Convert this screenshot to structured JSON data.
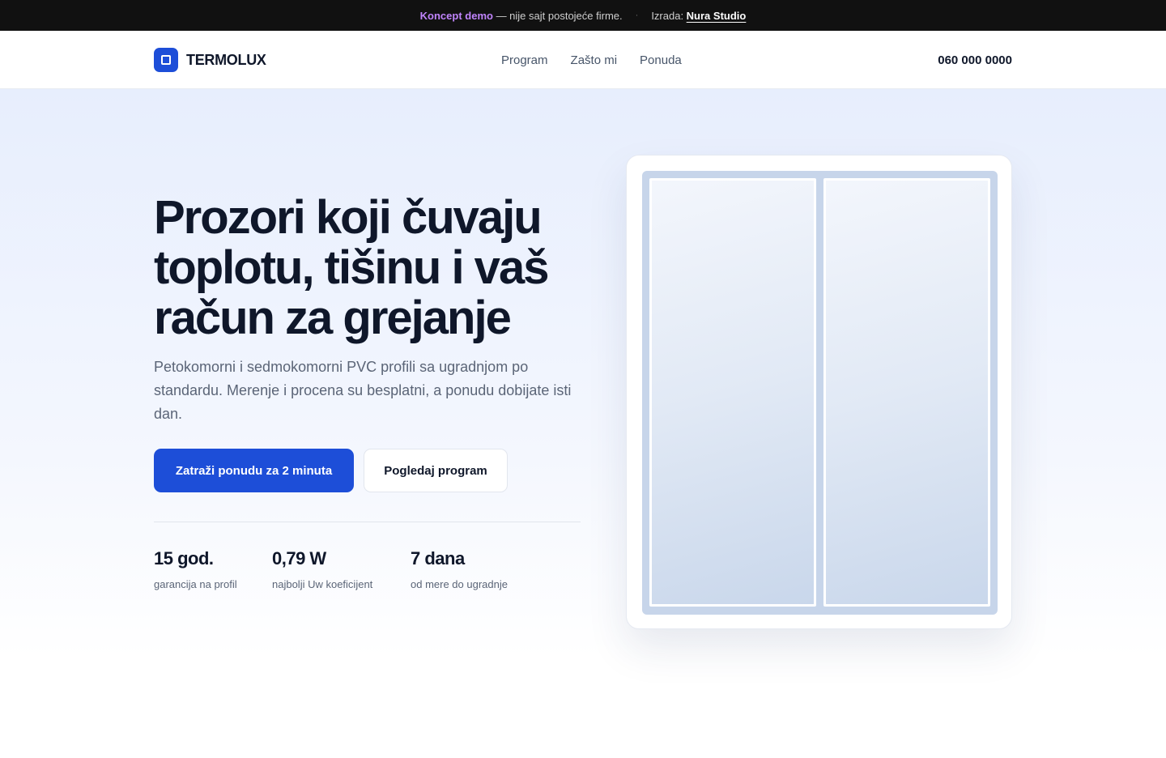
{
  "topbar": {
    "demo_label": "Koncept demo",
    "demo_note": " — nije sajt postojeće firme.",
    "separator": "·",
    "author_prefix": "Izrada: ",
    "author_name": "Nura Studio"
  },
  "nav": {
    "brand": "TERMOLUX",
    "links": [
      "Program",
      "Zašto mi",
      "Ponuda"
    ],
    "phone": "060 000 0000"
  },
  "hero": {
    "title": "Prozori koji čuvaju toplotu, tišinu i vaš račun za grejanje",
    "subtitle": "Petokomorni i sedmokomorni PVC profili sa ugradnjom po standardu. Merenje i procena su besplatni, a ponudu dobijate isti dan.",
    "primary_cta": "Zatraži ponudu za 2 minuta",
    "secondary_cta": "Pogledaj program",
    "stats": [
      {
        "value": "15 god.",
        "label": "garancija na profil"
      },
      {
        "value": "0,79 W",
        "label": "najbolji Uw koeficijent"
      },
      {
        "value": "7 dana",
        "label": "od mere do ugradnje"
      }
    ]
  },
  "icons": {
    "brand": "square-window-icon"
  },
  "colors": {
    "primary": "#1d4ed8",
    "topbar_bg": "#111111",
    "accent": "#c084fc"
  }
}
